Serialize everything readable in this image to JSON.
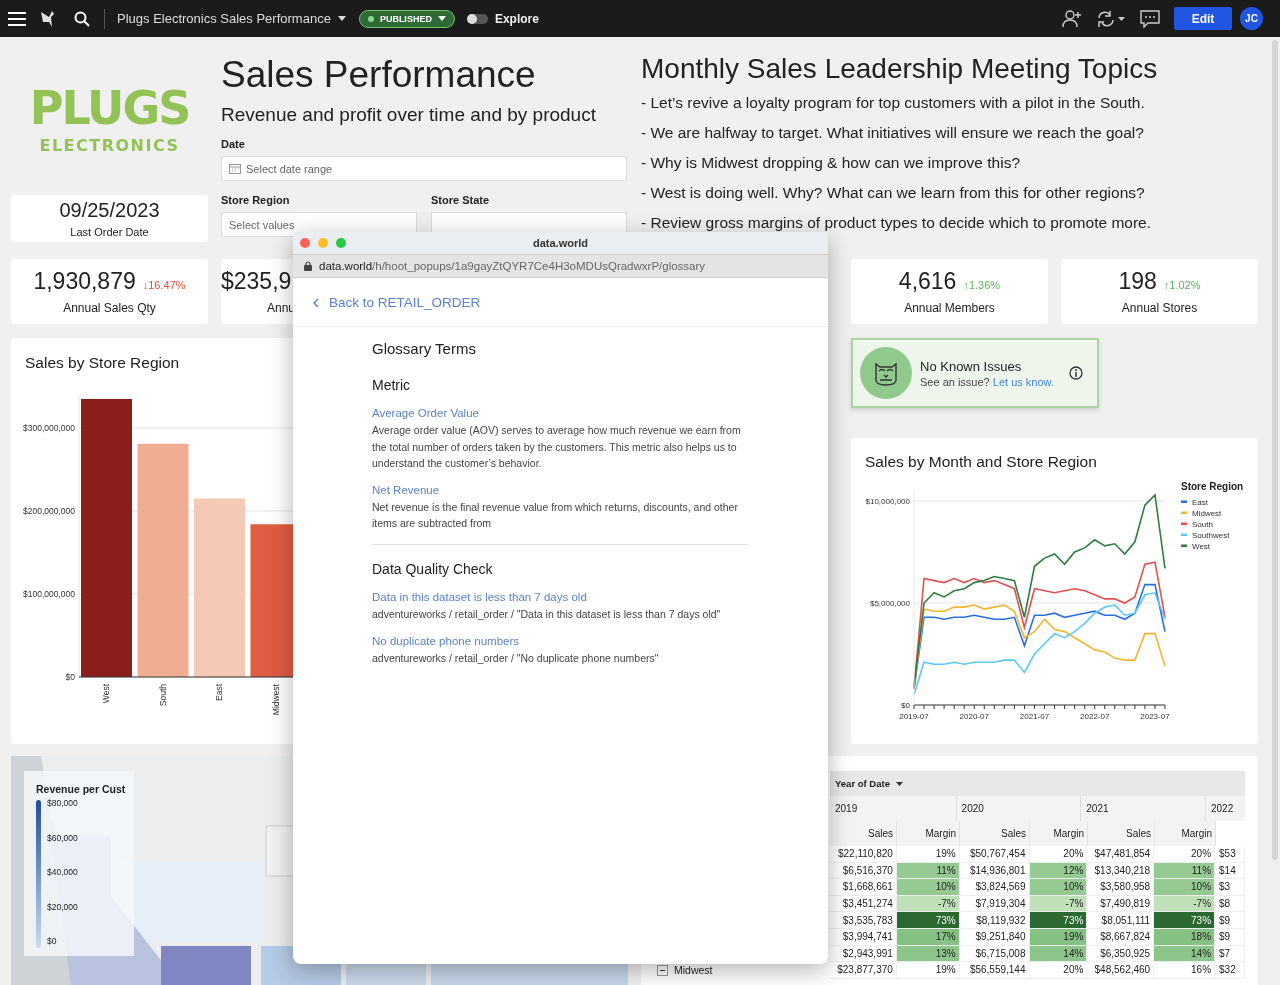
{
  "topbar": {
    "title": "Plugs Electronics Sales Performance",
    "status": "PUBLISHED",
    "explore": {
      "label": "Explore",
      "on": false
    },
    "edit": "Edit",
    "avatar": "JC"
  },
  "logo": {
    "word": "PLUGS",
    "sub": "ELECTRONICS"
  },
  "last_order": {
    "value": "09/25/2023",
    "label": "Last Order Date"
  },
  "header": {
    "title": "Sales Performance",
    "subtitle": "Revenue and profit over time and by product"
  },
  "filters": [
    {
      "label": "Date",
      "placeholder": "Select date range",
      "kind": "date"
    },
    {
      "label": "Store Region",
      "placeholder": "Select values",
      "kind": "select"
    },
    {
      "label": "Store State",
      "kind": "select"
    }
  ],
  "topics": {
    "title": "Monthly Sales Leadership Meeting Topics",
    "items": [
      "- Let’s revive a loyalty program for top customers with a pilot in the South.",
      "- We are halfway to target. What initiatives will ensure we reach the goal?",
      "- Why is Midwest dropping & how can we improve this?",
      "- West is doing well. Why? What can we learn from this for other regions?",
      "- Review gross margins of product types to decide which to promote more."
    ]
  },
  "kpis": [
    {
      "value": "1,930,879",
      "delta": "↓16.47%",
      "color": "#d9533f",
      "label": "Annual Sales Qty",
      "kind": "full"
    },
    {
      "value": "$235,9",
      "label": "Annu",
      "kind": "clipped"
    },
    {
      "kind": "hidden"
    },
    {
      "kind": "hidden"
    },
    {
      "value": "4,616",
      "delta": "↑1.36%",
      "color": "#5cb85c",
      "label": "Annual Members",
      "kind": "full"
    },
    {
      "value": "198",
      "delta": "↑1.02%",
      "color": "#5cb85c",
      "label": "Annual Stores",
      "kind": "full"
    }
  ],
  "bar_card": {
    "title": "Sales by Store Region",
    "chart_data": {
      "type": "bar",
      "categories": [
        "West",
        "South",
        "East",
        "Midwest"
      ],
      "values": [
        335000000,
        281000000,
        215000000,
        184000000
      ],
      "colors": [
        "#8b1d1b",
        "#f0ad91",
        "#f4c9b6",
        "#e05c43"
      ],
      "grid": true,
      "ylim": [
        0,
        340000000
      ],
      "yticks": [
        {
          "value": 0,
          "label": "$0"
        },
        {
          "value": 100000000,
          "label": "$100,000,000"
        },
        {
          "value": 200000000,
          "label": "$200,000,000"
        },
        {
          "value": 300000000,
          "label": "$300,000,000"
        }
      ]
    }
  },
  "issues": {
    "title": "No Known Issues",
    "prompt": "See an issue? ",
    "link": "Let us know."
  },
  "line_card": {
    "title": "Sales by Month and Store Region",
    "chart_data": {
      "type": "line",
      "legend": {
        "title": "Store Region"
      },
      "grid": true,
      "ylim": [
        0,
        10500000
      ],
      "categories": [
        "2019-07",
        null,
        null,
        null,
        null,
        null,
        "2020-07",
        null,
        null,
        null,
        null,
        null,
        "2021-07",
        null,
        null,
        null,
        null,
        null,
        "2022-07",
        null,
        null,
        null,
        null,
        null,
        "2023-07",
        null
      ],
      "series": [
        {
          "name": "East",
          "color": "#2a6fdb",
          "values": [
            800000,
            4300000,
            4300000,
            4200000,
            4300000,
            4300000,
            4400000,
            4300000,
            4200000,
            4200000,
            4300000,
            2900000,
            4400000,
            4400000,
            4500000,
            4300000,
            4400000,
            4500000,
            4600000,
            4400000,
            4400000,
            4200000,
            4500000,
            5900000,
            5900000,
            3600000
          ]
        },
        {
          "name": "Midwest",
          "color": "#f2b632",
          "values": [
            800000,
            4700000,
            4600000,
            4600000,
            4800000,
            4800000,
            4900000,
            4700000,
            4800000,
            4900000,
            4600000,
            3300000,
            3600000,
            4200000,
            3700000,
            3600000,
            3300000,
            3000000,
            2700000,
            2600000,
            2300000,
            2200000,
            2200000,
            3500000,
            3500000,
            1900000
          ]
        },
        {
          "name": "South",
          "color": "#e05252",
          "values": [
            800000,
            6200000,
            6100000,
            6000000,
            6200000,
            6000000,
            6200000,
            6000000,
            6100000,
            5900000,
            5700000,
            3800000,
            5700000,
            5600000,
            5500000,
            5600000,
            5700000,
            5600000,
            5400000,
            5200000,
            5200000,
            5000000,
            5300000,
            6900000,
            7000000,
            4300000
          ]
        },
        {
          "name": "Southwest",
          "color": "#5ac8fa",
          "values": [
            500000,
            2100000,
            2000000,
            2000000,
            2100000,
            2000000,
            2100000,
            2100000,
            2100000,
            2200000,
            2200000,
            1600000,
            2500000,
            3000000,
            3500000,
            3300000,
            3600000,
            4000000,
            4500000,
            4800000,
            4900000,
            4400000,
            4500000,
            5400000,
            5500000,
            4200000
          ]
        },
        {
          "name": "West",
          "color": "#2e7d3e",
          "values": [
            900000,
            5000000,
            5500000,
            5300000,
            5600000,
            5700000,
            6000000,
            6100000,
            6300000,
            6200000,
            6100000,
            4300000,
            6800000,
            7200000,
            7400000,
            6900000,
            7500000,
            7700000,
            8100000,
            7800000,
            7900000,
            7400000,
            8000000,
            9800000,
            10300000,
            6700000
          ]
        }
      ],
      "yticks": [
        {
          "value": 0,
          "label": "$0"
        },
        {
          "value": 5000000,
          "label": "$5,000,000"
        },
        {
          "value": 10000000,
          "label": "$10,000,000"
        }
      ]
    }
  },
  "map": {
    "kind": "picture",
    "legend": {
      "title": "Revenue per Cust",
      "ticks": [
        "$80,000",
        "$60,000",
        "$40,000",
        "$20,000",
        "$0"
      ]
    }
  },
  "pivot": {
    "column_header": "Year of Date",
    "years": [
      "2019",
      "2020",
      "2021",
      "2022"
    ],
    "measures": [
      "Sales",
      "Margin",
      "Sales",
      "Margin",
      "Sales",
      "Margin"
    ],
    "rows": [
      {
        "kind": "group",
        "cells": [
          "$22,110,820",
          "19%",
          "$50,767,454",
          "20%",
          "$47,481,854",
          "20%",
          "$53"
        ]
      },
      {
        "kind": "item",
        "cells": [
          "$6,516,370",
          "11%",
          "$14,936,801",
          "12%",
          "$13,340,218",
          "11%",
          "$14"
        ]
      },
      {
        "kind": "item",
        "cells": [
          "$1,668,661",
          "10%",
          "$3,824,569",
          "10%",
          "$3,580,958",
          "10%",
          "$3"
        ]
      },
      {
        "kind": "item",
        "cells": [
          "$3,451,274",
          "-7%",
          "$7,919,304",
          "-7%",
          "$7,490,819",
          "-7%",
          "$8"
        ]
      },
      {
        "kind": "item",
        "cells": [
          "$3,535,783",
          "73%",
          "$8,119,932",
          "73%",
          "$8,051,111",
          "73%",
          "$9"
        ]
      },
      {
        "kind": "item",
        "cells": [
          "$3,994,741",
          "17%",
          "$9,251,840",
          "19%",
          "$8,667,824",
          "18%",
          "$9"
        ]
      },
      {
        "kind": "item",
        "cells": [
          "$2,943,991",
          "13%",
          "$6,715,008",
          "14%",
          "$6,350,925",
          "14%",
          "$7"
        ]
      },
      {
        "kind": "group",
        "label": "Midwest",
        "expanded": true,
        "cells": [
          "$23,877,370",
          "19%",
          "$56,559,144",
          "20%",
          "$48,562,460",
          "16%",
          "$32"
        ]
      }
    ]
  },
  "popup": {
    "window_title": "data.world",
    "url_host": "data.world",
    "url_path": "/h/hoot_popups/1a9gayZtQYR7Ce4H3oMDUsQradwxrP/glossary",
    "back": "Back to RETAIL_ORDER",
    "heading": "Glossary Terms",
    "sections": [
      {
        "title": "Metric",
        "items": [
          {
            "name": "Average Order Value",
            "text": "Average order value (AOV) serves to average how much revenue we earn from the total number of orders taken by the customers. This metric also helps us to understand the customer’s behavior."
          },
          {
            "name": "Net Revenue",
            "text": "Net revenue is the final revenue value from which returns, discounts, and other items are subtracted from"
          }
        ]
      },
      {
        "title": "Data Quality Check",
        "items": [
          {
            "name": "Data in this dataset is less than 7 days old",
            "text": "adventureworks / retail_order / \"Data in this dataset is less than 7 days old\""
          },
          {
            "name": "No duplicate phone numbers",
            "text": "adventureworks / retail_order / \"No duplicate phone numbers\""
          }
        ]
      }
    ]
  }
}
